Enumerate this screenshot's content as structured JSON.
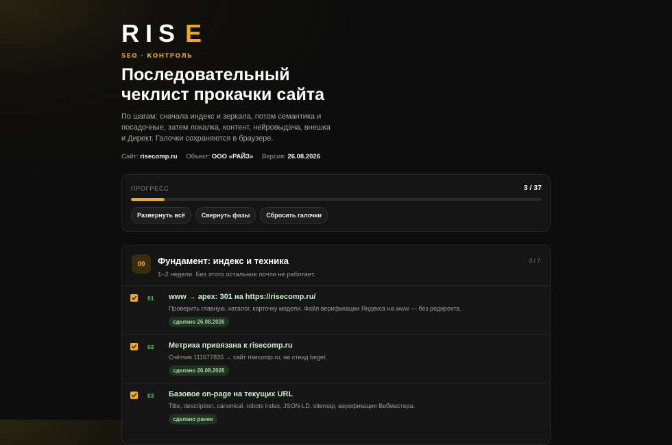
{
  "brand": {
    "logo_main": "RIS",
    "logo_accent": "E",
    "accent_color": "#f0a81e"
  },
  "header": {
    "kicker": "SEO · КОНТРОЛЬ",
    "title": "Последовательный чеклист прокачки сайта",
    "description": "По шагам: сначала индекс и зеркала, потом семантика и посадочные, затем локалка, контент, нейровыдача, внешка и Директ. Галочки сохраняются в браузере.",
    "meta": [
      {
        "label": "Сайт:",
        "value": "risecomp.ru"
      },
      {
        "label": "Объект:",
        "value": "ООО «РАЙЗ»"
      },
      {
        "label": "Версия:",
        "value": "26.08.2026"
      }
    ]
  },
  "progress": {
    "label": "ПРОГРЕСС",
    "count_text": "3 / 37",
    "done": 3,
    "total": 37,
    "buttons": {
      "expand_all": "Развернуть всё",
      "collapse_phases": "Свернуть фазы",
      "reset_checks": "Сбросить галочки"
    }
  },
  "phase": {
    "number": "00",
    "title": "Фундамент: индекс и техника",
    "count": "3 / 7",
    "subtitle": "1–2 недели. Без этого остальное почти не работает.",
    "tasks": [
      {
        "num": "01",
        "checked": true,
        "title": "www → apex: 301 на https://risecomp.ru/",
        "desc": "Проверить главную, каталог, карточку модели. Файл верификации Яндекса на www — без редиректа.",
        "badge": "сделано 26.08.2026"
      },
      {
        "num": "02",
        "checked": true,
        "title": "Метрика привязана к risecomp.ru",
        "desc": "Счётчик 111677835 → сайт risecomp.ru, не стенд beget.",
        "badge": "сделано 26.08.2026"
      },
      {
        "num": "03",
        "checked": true,
        "title": "Базовое on-page на текущих URL",
        "desc": "Title, description, canonical, robots index, JSON-LD, sitemap, верификация Вебмастера.",
        "badge": "сделано ранее"
      }
    ]
  }
}
